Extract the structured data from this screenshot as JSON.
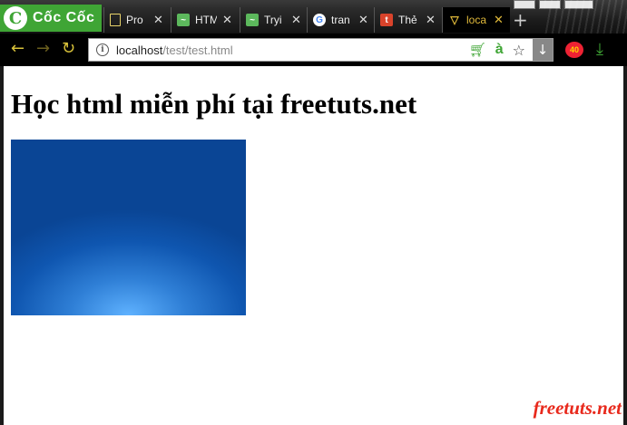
{
  "browser": {
    "brand_name": "Cốc Cốc",
    "brand_logo_letter": "C",
    "tabs": [
      {
        "title": "Pro",
        "icon": "page-icon",
        "active": false
      },
      {
        "title": "HTM",
        "icon": "wave-icon",
        "active": false
      },
      {
        "title": "Tryi",
        "icon": "wave-icon",
        "active": false
      },
      {
        "title": "tran",
        "icon": "google-icon",
        "active": false
      },
      {
        "title": "Thẻ",
        "icon": "template-icon",
        "active": false
      },
      {
        "title": "loca",
        "icon": "loading-icon",
        "active": true
      }
    ],
    "close_glyph": "✕",
    "new_tab_glyph": "+",
    "url_host": "localhost",
    "url_path": "/test/test.html",
    "accent_color": "#3fa535"
  },
  "page": {
    "heading": "Học html miễn phí tại freetuts.net",
    "watermark": "freetuts.net"
  }
}
